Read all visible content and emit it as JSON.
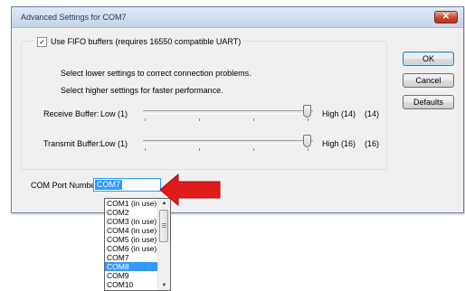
{
  "window": {
    "title": "Advanced Settings for COM7",
    "close_label": "✕"
  },
  "fifo": {
    "checkbox_label": "Use FIFO buffers (requires 16550 compatible UART)",
    "checked": true,
    "hint_lower": "Select lower settings to correct connection problems.",
    "hint_higher": "Select higher settings for faster performance."
  },
  "receive_buffer": {
    "label": "Receive Buffer:",
    "low_label": "Low (1)",
    "high_label": "High (14)",
    "value_label": "(14)",
    "value": 14,
    "max": 14
  },
  "transmit_buffer": {
    "label": "Transmit Buffer:",
    "low_label": "Low (1)",
    "high_label": "High (16)",
    "value_label": "(16)",
    "value": 16,
    "max": 16
  },
  "buttons": {
    "ok": "OK",
    "cancel": "Cancel",
    "defaults": "Defaults"
  },
  "com_port": {
    "label": "COM Port Number:",
    "selected": "COM7",
    "options": [
      "COM1 (in use)",
      "COM2",
      "COM3 (in use)",
      "COM4 (in use)",
      "COM5 (in use)",
      "COM6 (in use)",
      "COM7",
      "COM8",
      "COM9",
      "COM10"
    ],
    "highlighted": "COM8"
  },
  "colors": {
    "highlight": "#3399ff",
    "arrow": "#e01b1b"
  }
}
